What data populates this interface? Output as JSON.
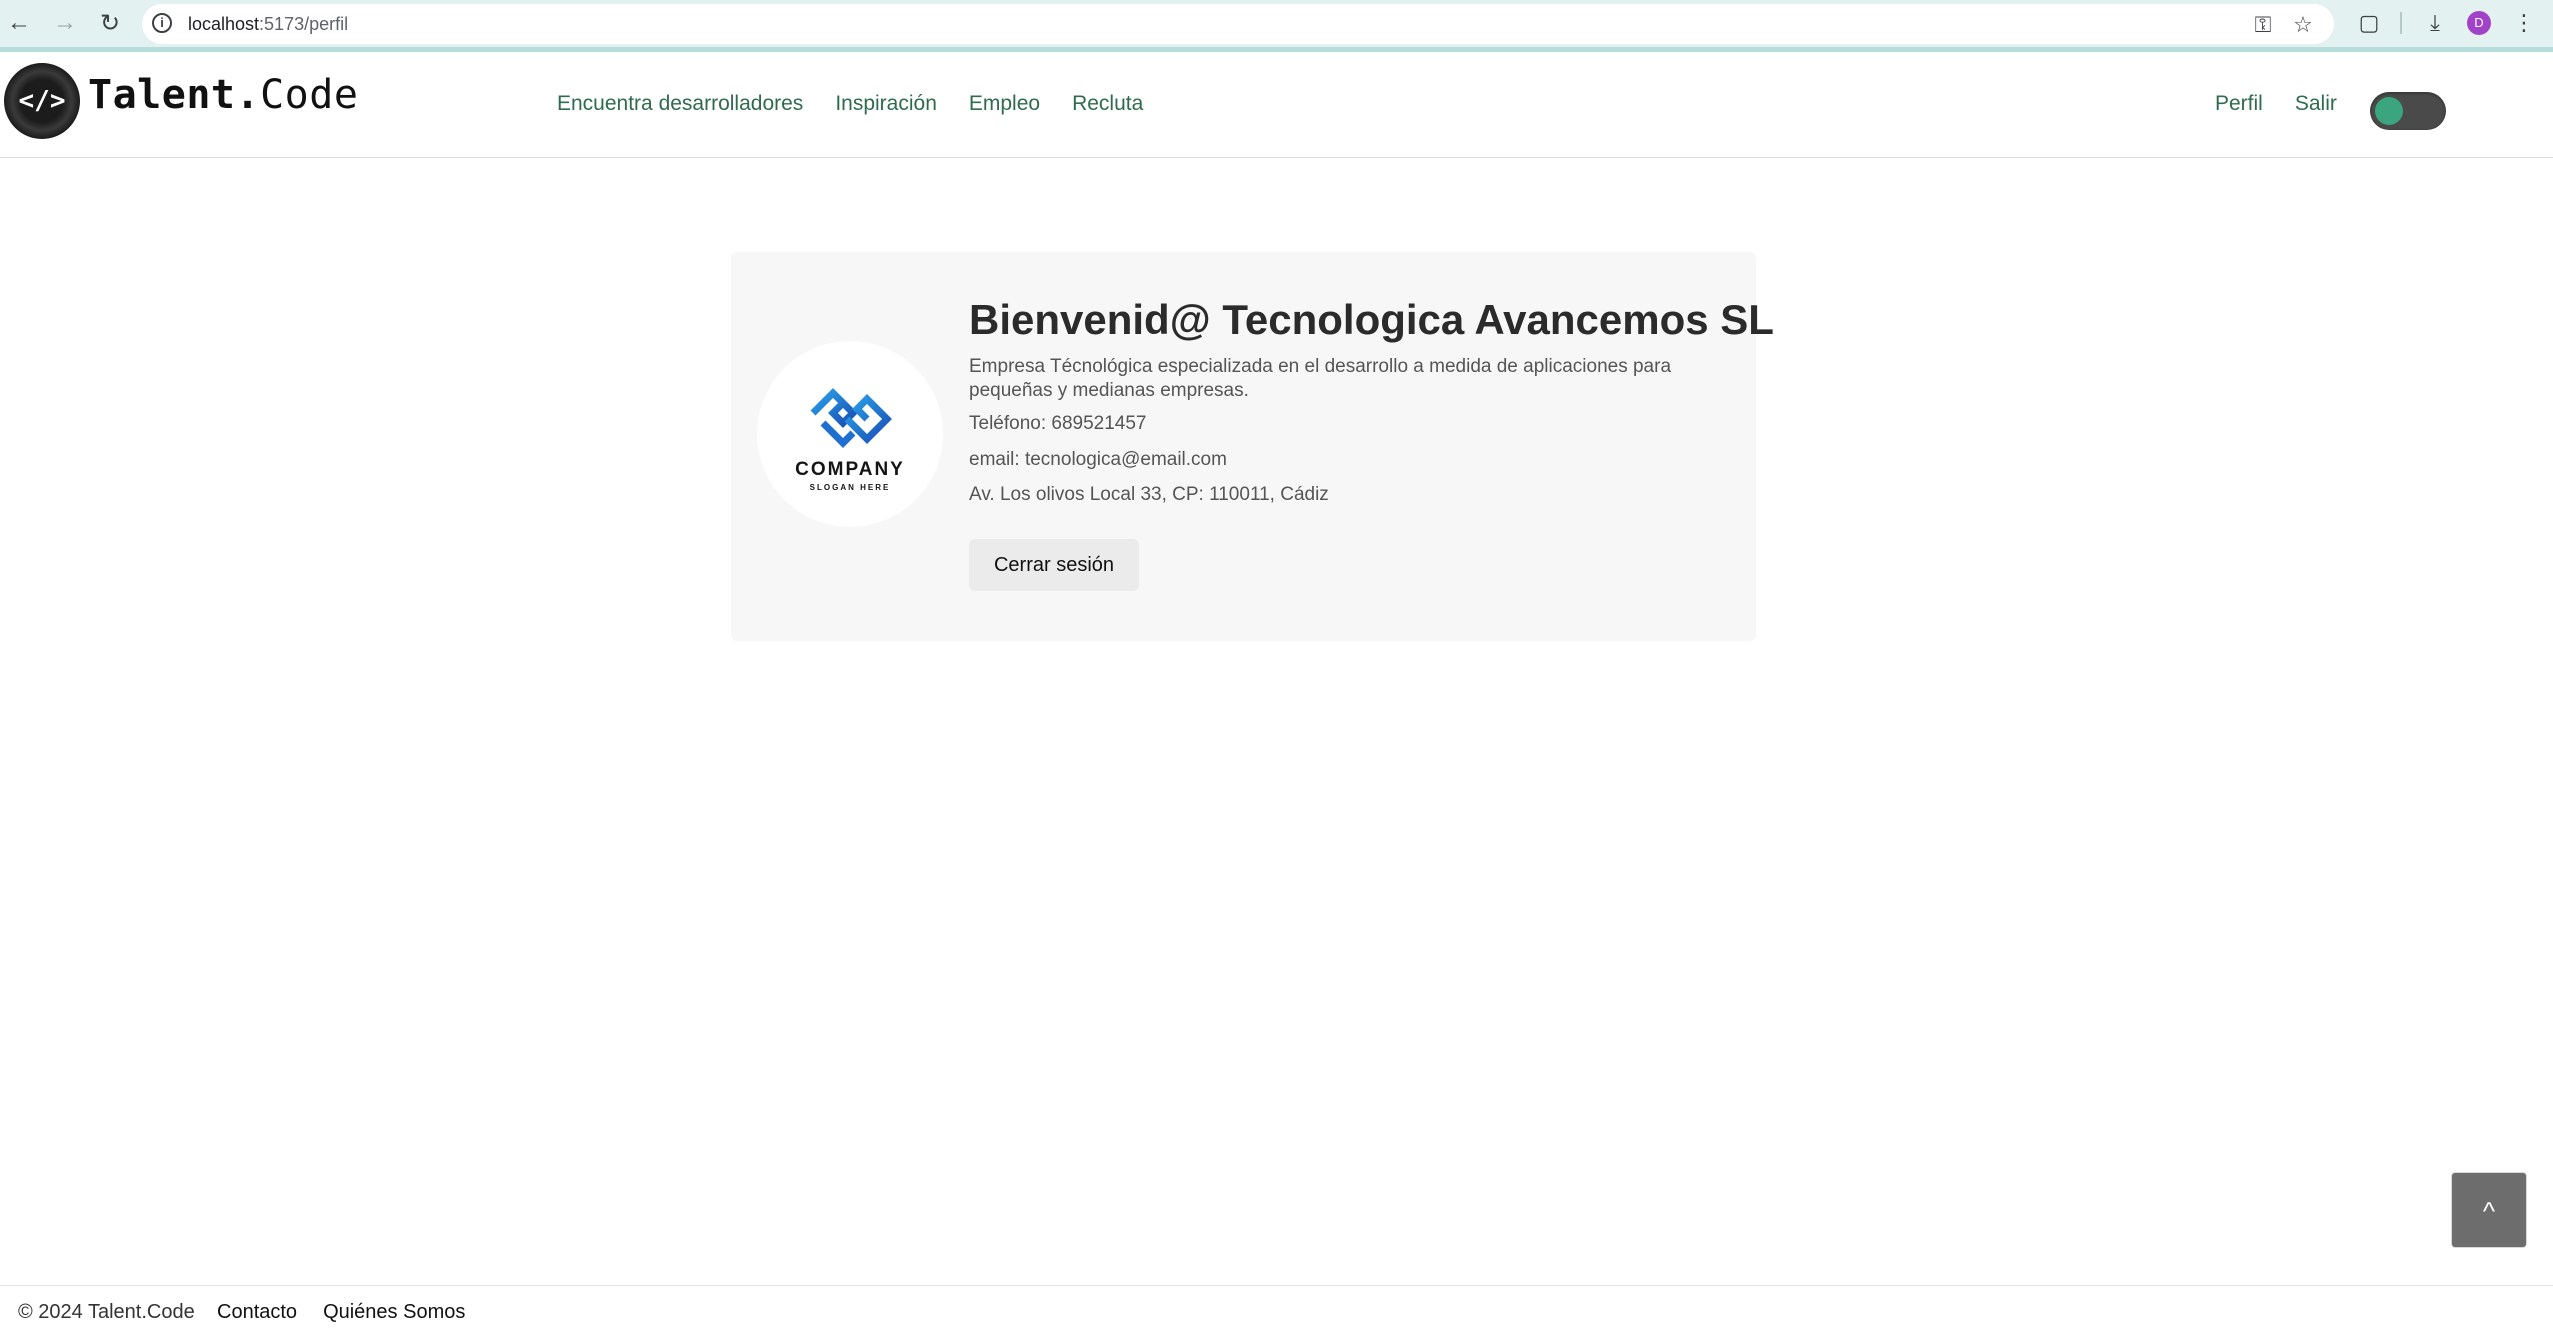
{
  "browser": {
    "url_host": "localhost",
    "url_path": ":5173/perfil",
    "profile_initial": "D"
  },
  "header": {
    "logo_glyph": "</>",
    "brand_bold": "Talent.",
    "brand_regular": "Code",
    "nav": [
      "Encuentra desarrolladores",
      "Inspiración",
      "Empleo",
      "Recluta"
    ],
    "user_nav": [
      "Perfil",
      "Salir"
    ],
    "theme_toggle_on": true
  },
  "profile": {
    "logo_name": "COMPANY",
    "logo_slogan": "SLOGAN HERE",
    "title": "Bienvenid@ Tecnologica Avancemos SL",
    "description": "Empresa Técnológica especializada en el desarrollo a medida de aplicaciones para pequeñas y medianas empresas.",
    "phone": "Teléfono: 689521457",
    "email": "email: tecnologica@email.com",
    "address": "Av. Los olivos Local 33, CP: 110011, Cádiz",
    "logout_label": "Cerrar sesión"
  },
  "scroll_top_label": "^",
  "footer": {
    "copyright": "© 2024 Talent.Code",
    "links": [
      "Contacto",
      "Quiénes Somos"
    ]
  },
  "colors": {
    "nav_link": "#2f6b4f",
    "toggle_knob": "#3aa57f",
    "card_bg": "#f7f7f7",
    "logo_blue": "#1f7fd6"
  }
}
